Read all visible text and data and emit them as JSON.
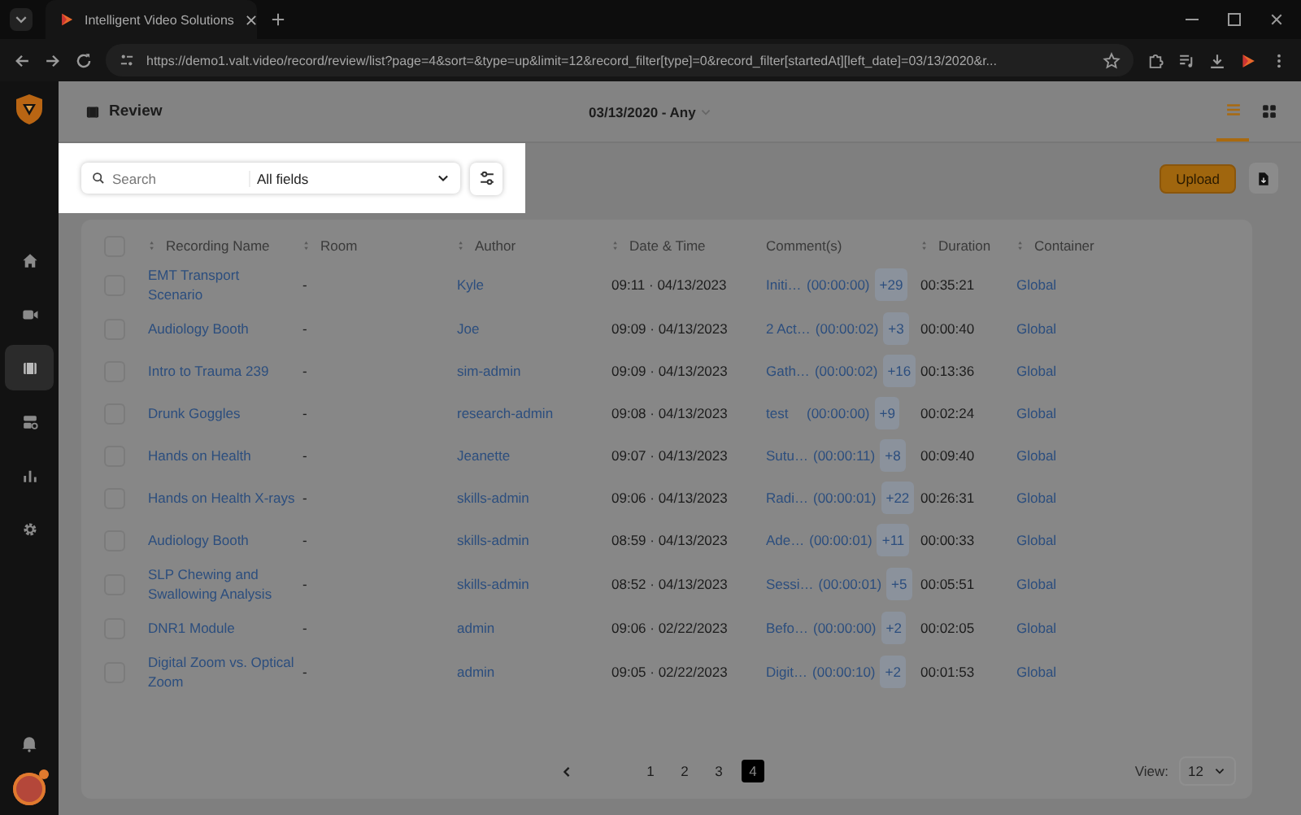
{
  "browser": {
    "tab_title": "Intelligent Video Solutions",
    "url": "https://demo1.valt.video/record/review/list?page=4&sort=&type=up&limit=12&record_filter[type]=0&record_filter[startedAt][left_date]=03/13/2020&r..."
  },
  "sidebar": {
    "items": [
      {
        "kind": "home",
        "selected": false
      },
      {
        "kind": "video",
        "selected": false
      },
      {
        "kind": "film",
        "selected": true
      },
      {
        "kind": "storage",
        "selected": false
      },
      {
        "kind": "chart",
        "selected": false
      },
      {
        "kind": "settings",
        "selected": false
      }
    ]
  },
  "header": {
    "title": "Review",
    "date_filter": "03/13/2020 - Any",
    "views": [
      {
        "kind": "list",
        "selected": true
      },
      {
        "kind": "grid",
        "selected": false
      }
    ]
  },
  "search": {
    "placeholder": "Search",
    "scope": "All fields"
  },
  "toolbar": {
    "upload": "Upload"
  },
  "table": {
    "select_all_checked": false,
    "columns": [
      {
        "label": "Recording Name",
        "sortable": true
      },
      {
        "label": "Room",
        "sortable": true
      },
      {
        "label": "Author",
        "sortable": true
      },
      {
        "label": "Date & Time",
        "sortable": true
      },
      {
        "label": "Comment(s)",
        "sortable": false
      },
      {
        "label": "Duration",
        "sortable": true
      },
      {
        "label": "Container",
        "sortable": true
      }
    ],
    "rows": [
      {
        "checked": false,
        "name": "EMT Transport Scenario",
        "room": "-",
        "author": "Kyle",
        "datetime": "09:11 · 04/13/2023",
        "comment": "Initi…",
        "comment_time": "(00:00:00)",
        "more": "+29",
        "duration": "00:35:21",
        "container": "Global"
      },
      {
        "checked": false,
        "name": "Audiology Booth",
        "room": "-",
        "author": "Joe",
        "datetime": "09:09 · 04/13/2023",
        "comment": "2 Act…",
        "comment_time": "(00:00:02)",
        "more": "+3",
        "duration": "00:00:40",
        "container": "Global"
      },
      {
        "checked": false,
        "name": "Intro to Trauma 239",
        "room": "-",
        "author": "sim-admin",
        "datetime": "09:09 · 04/13/2023",
        "comment": "Gath…",
        "comment_time": "(00:00:02)",
        "more": "+16",
        "duration": "00:13:36",
        "container": "Global"
      },
      {
        "checked": false,
        "name": "Drunk Goggles",
        "room": "-",
        "author": "research-admin",
        "datetime": "09:08 · 04/13/2023",
        "comment": "test",
        "comment_time": "(00:00:00)",
        "more": "+9",
        "duration": "00:02:24",
        "container": "Global"
      },
      {
        "checked": false,
        "name": "Hands on Health",
        "room": "-",
        "author": "Jeanette",
        "datetime": "09:07 · 04/13/2023",
        "comment": "Sutu…",
        "comment_time": "(00:00:11)",
        "more": "+8",
        "duration": "00:09:40",
        "container": "Global"
      },
      {
        "checked": false,
        "name": "Hands on Health X-rays",
        "room": "-",
        "author": "skills-admin",
        "datetime": "09:06 · 04/13/2023",
        "comment": "Radi…",
        "comment_time": "(00:00:01)",
        "more": "+22",
        "duration": "00:26:31",
        "container": "Global"
      },
      {
        "checked": false,
        "name": "Audiology Booth",
        "room": "-",
        "author": "skills-admin",
        "datetime": "08:59 · 04/13/2023",
        "comment": "Ade…",
        "comment_time": "(00:00:01)",
        "more": "+11",
        "duration": "00:00:33",
        "container": "Global"
      },
      {
        "checked": false,
        "name": "SLP Chewing and Swallowing Analysis",
        "room": "-",
        "author": "skills-admin",
        "datetime": "08:52 · 04/13/2023",
        "comment": "Sessi…",
        "comment_time": "(00:00:01)",
        "more": "+5",
        "duration": "00:05:51",
        "container": "Global"
      },
      {
        "checked": false,
        "name": "DNR1 Module",
        "room": "-",
        "author": "admin",
        "datetime": "09:06 · 02/22/2023",
        "comment": "Befo…",
        "comment_time": "(00:00:00)",
        "more": "+2",
        "duration": "00:02:05",
        "container": "Global"
      },
      {
        "checked": false,
        "name": "Digital Zoom vs. Optical Zoom",
        "room": "-",
        "author": "admin",
        "datetime": "09:05 · 02/22/2023",
        "comment": "Digit…",
        "comment_time": "(00:00:10)",
        "more": "+2",
        "duration": "00:01:53",
        "container": "Global"
      }
    ]
  },
  "pagination": {
    "pages": [
      {
        "label": "1",
        "selected": false
      },
      {
        "label": "2",
        "selected": false
      },
      {
        "label": "3",
        "selected": false
      },
      {
        "label": "4",
        "selected": true
      }
    ],
    "view_label": "View:",
    "view_value": "12"
  }
}
